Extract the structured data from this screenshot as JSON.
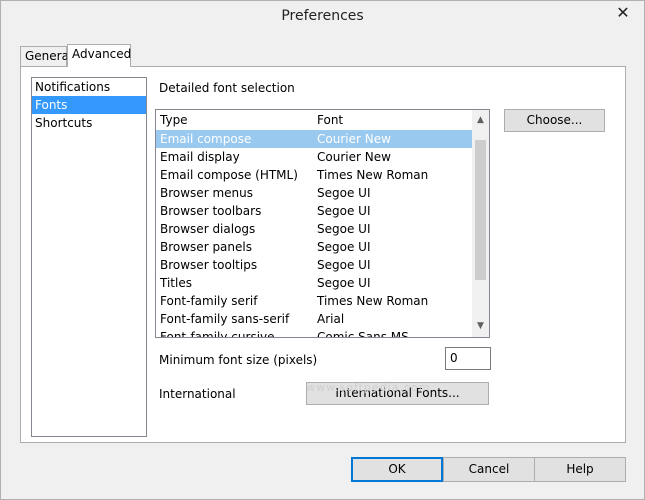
{
  "window": {
    "title": "Preferences",
    "close_glyph": "✕"
  },
  "tabs": [
    {
      "label": "General"
    },
    {
      "label": "Advanced"
    }
  ],
  "sidebar": {
    "items": [
      {
        "label": "Notifications"
      },
      {
        "label": "Fonts"
      },
      {
        "label": "Shortcuts"
      }
    ],
    "selected": "Fonts"
  },
  "fonts": {
    "section_label": "Detailed font selection",
    "columns": {
      "type": "Type",
      "font": "Font"
    },
    "rows": [
      {
        "type": "Email compose",
        "font": "Courier New"
      },
      {
        "type": "Email display",
        "font": "Courier New"
      },
      {
        "type": "Email compose (HTML)",
        "font": "Times New Roman"
      },
      {
        "type": "Browser menus",
        "font": "Segoe UI"
      },
      {
        "type": "Browser toolbars",
        "font": "Segoe UI"
      },
      {
        "type": "Browser dialogs",
        "font": "Segoe UI"
      },
      {
        "type": "Browser panels",
        "font": "Segoe UI"
      },
      {
        "type": "Browser tooltips",
        "font": "Segoe UI"
      },
      {
        "type": "Titles",
        "font": "Segoe UI"
      },
      {
        "type": "Font-family serif",
        "font": "Times New Roman"
      },
      {
        "type": "Font-family sans-serif",
        "font": "Arial"
      },
      {
        "type": "Font-family cursive",
        "font": "Comic Sans MS"
      }
    ],
    "selected_row": "Email compose",
    "choose_label": "Choose...",
    "min_size_label": "Minimum font size (pixels)",
    "min_size_value": "0",
    "international_label": "International",
    "international_button": "International Fonts..."
  },
  "footer": {
    "ok_label": "OK",
    "cancel_label": "Cancel",
    "help_label": "Help"
  },
  "watermark": "www.softpedia.com",
  "colors": {
    "selection_blue": "#3399ff",
    "row_highlight": "#99c9ef",
    "ok_border": "#0078d7"
  },
  "icons": {
    "scroll_up": "chevron-up-icon",
    "scroll_down": "chevron-down-icon",
    "close": "close-icon"
  }
}
